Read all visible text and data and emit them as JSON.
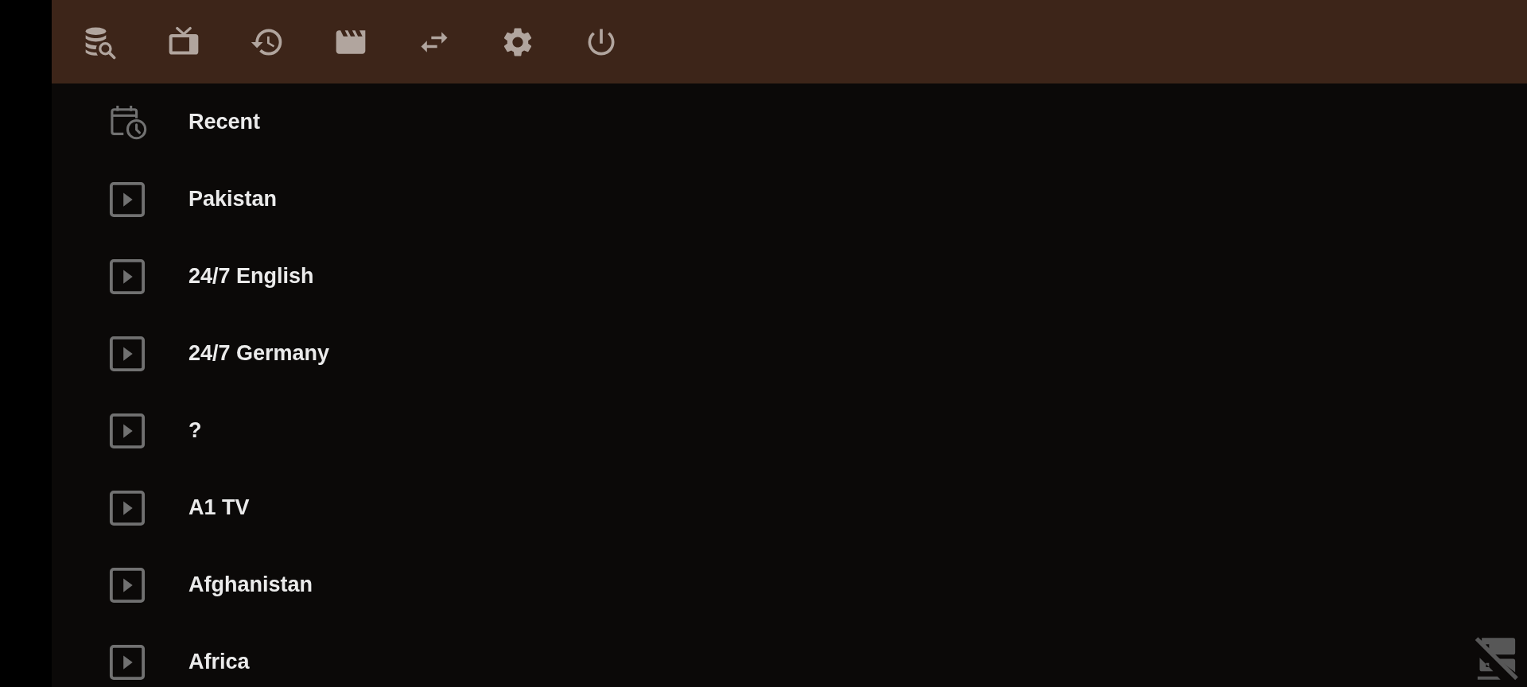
{
  "categories": [
    {
      "kind": "recent",
      "label": "Recent"
    },
    {
      "kind": "group",
      "label": "Pakistan"
    },
    {
      "kind": "group",
      "label": "24/7 English"
    },
    {
      "kind": "group",
      "label": "24/7 Germany"
    },
    {
      "kind": "group",
      "label": "?"
    },
    {
      "kind": "group",
      "label": "A1 TV"
    },
    {
      "kind": "group",
      "label": "Afghanistan"
    },
    {
      "kind": "group",
      "label": "Africa"
    }
  ]
}
